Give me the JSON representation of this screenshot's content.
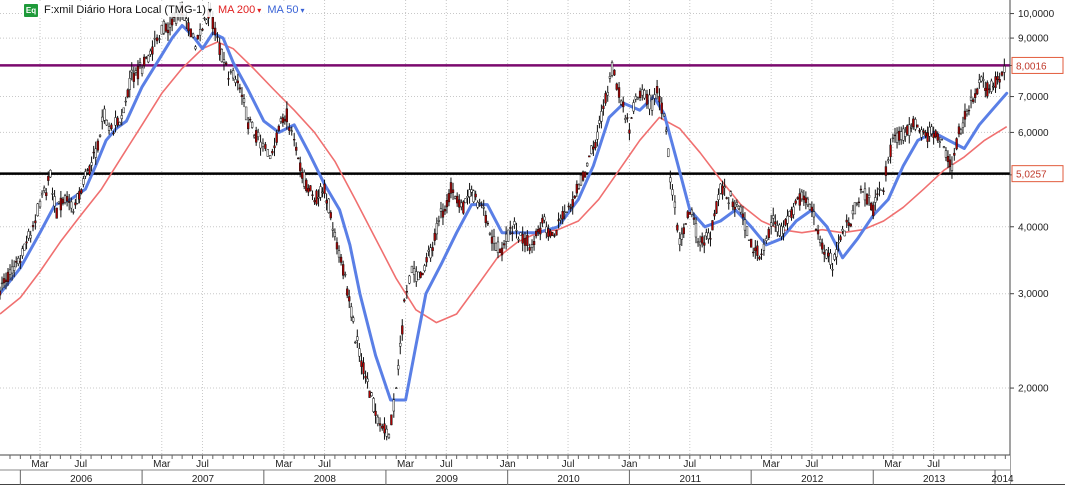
{
  "legend": {
    "badge": "Eq",
    "symbol": "F:xmil Diário Hora Local (TMG-1)",
    "ma200_label": "MA 200",
    "ma50_label": "MA 50",
    "caret": "▾"
  },
  "colors": {
    "price": "#111111",
    "price_down_body": "#b00000",
    "ma200": "#f07070",
    "ma50": "#5a7fe6",
    "upper_line": "#7b0a6e",
    "lower_line": "#000000",
    "upper_badge": "#e25b3c",
    "lower_badge": "#e25b3c",
    "grid": "#c8c8c8",
    "badge_eq": "#1f9a3a"
  },
  "chart_data": {
    "type": "line",
    "y_scale": "log",
    "ylim": [
      1.5,
      10.6
    ],
    "y_ticks": [
      "10,0000",
      "9,0000",
      "8,0000",
      "7,0000",
      "6,0000",
      "5,0000",
      "4,0000",
      "3,0000",
      "2,0000"
    ],
    "y_tick_values": [
      10,
      9,
      8,
      7,
      6,
      5,
      4,
      3,
      2
    ],
    "xlim": [
      "2005-11-01",
      "2014-02-15"
    ],
    "grid": true,
    "legend_position": "top-left",
    "month_ticks": [
      {
        "label": "Mar",
        "date": "2006-03-01"
      },
      {
        "label": "Jul",
        "date": "2006-07-01"
      },
      {
        "label": "Mar",
        "date": "2007-03-01"
      },
      {
        "label": "Jul",
        "date": "2007-07-01"
      },
      {
        "label": "Mar",
        "date": "2008-03-01"
      },
      {
        "label": "Jul",
        "date": "2008-07-01"
      },
      {
        "label": "Mar",
        "date": "2009-03-01"
      },
      {
        "label": "Jul",
        "date": "2009-07-01"
      },
      {
        "label": "Jan",
        "date": "2010-01-01"
      },
      {
        "label": "Jul",
        "date": "2010-07-01"
      },
      {
        "label": "Jan",
        "date": "2011-01-01"
      },
      {
        "label": "Jul",
        "date": "2011-07-01"
      },
      {
        "label": "Mar",
        "date": "2012-03-01"
      },
      {
        "label": "Jul",
        "date": "2012-07-01"
      },
      {
        "label": "Mar",
        "date": "2013-03-01"
      },
      {
        "label": "Jul",
        "date": "2013-07-01"
      }
    ],
    "year_ticks": [
      {
        "label": "2006",
        "start": "2006-01-01"
      },
      {
        "label": "2007",
        "start": "2007-01-01"
      },
      {
        "label": "2008",
        "start": "2008-01-01"
      },
      {
        "label": "2009",
        "start": "2009-01-01"
      },
      {
        "label": "2010",
        "start": "2010-01-01"
      },
      {
        "label": "2011",
        "start": "2011-01-01"
      },
      {
        "label": "2012",
        "start": "2012-01-01"
      },
      {
        "label": "2013",
        "start": "2013-01-01"
      },
      {
        "label": "2014",
        "start": "2014-01-01"
      }
    ],
    "horizontal_lines": [
      {
        "value": 8.0016,
        "label": "8,0016",
        "color_key": "upper_line"
      },
      {
        "value": 5.0257,
        "label": "5,0257",
        "color_key": "lower_line"
      }
    ],
    "series": [
      {
        "name": "F:xmil",
        "role": "price",
        "points": [
          [
            "2005-11-01",
            3.05
          ],
          [
            "2005-12-01",
            3.25
          ],
          [
            "2006-01-01",
            3.55
          ],
          [
            "2006-02-01",
            3.9
          ],
          [
            "2006-03-01",
            4.4
          ],
          [
            "2006-04-01",
            4.95
          ],
          [
            "2006-04-20",
            4.25
          ],
          [
            "2006-05-15",
            4.55
          ],
          [
            "2006-06-15",
            4.35
          ],
          [
            "2006-07-15",
            4.95
          ],
          [
            "2006-08-15",
            5.5
          ],
          [
            "2006-09-10",
            6.45
          ],
          [
            "2006-10-01",
            6.1
          ],
          [
            "2006-11-01",
            6.4
          ],
          [
            "2006-12-01",
            7.6
          ],
          [
            "2007-01-01",
            7.9
          ],
          [
            "2007-02-01",
            8.7
          ],
          [
            "2007-03-01",
            9.3
          ],
          [
            "2007-04-01",
            9.6
          ],
          [
            "2007-05-01",
            10.2
          ],
          [
            "2007-05-20",
            9.5
          ],
          [
            "2007-06-10",
            8.6
          ],
          [
            "2007-07-01",
            9.4
          ],
          [
            "2007-07-25",
            10.15
          ],
          [
            "2007-08-15",
            8.8
          ],
          [
            "2007-09-10",
            7.9
          ],
          [
            "2007-10-15",
            7.4
          ],
          [
            "2007-11-15",
            6.3
          ],
          [
            "2007-12-15",
            5.8
          ],
          [
            "2008-01-20",
            5.4
          ],
          [
            "2008-02-15",
            6.1
          ],
          [
            "2008-03-10",
            6.5
          ],
          [
            "2008-04-01",
            5.8
          ],
          [
            "2008-05-01",
            4.9
          ],
          [
            "2008-06-01",
            4.5
          ],
          [
            "2008-07-01",
            4.7
          ],
          [
            "2008-08-01",
            3.9
          ],
          [
            "2008-09-01",
            3.2
          ],
          [
            "2008-10-01",
            2.5
          ],
          [
            "2008-11-01",
            2.1
          ],
          [
            "2008-12-01",
            1.8
          ],
          [
            "2009-01-10",
            1.62
          ],
          [
            "2009-02-01",
            2.0
          ],
          [
            "2009-02-25",
            2.85
          ],
          [
            "2009-03-20",
            3.3
          ],
          [
            "2009-04-15",
            3.2
          ],
          [
            "2009-05-15",
            3.6
          ],
          [
            "2009-06-15",
            4.2
          ],
          [
            "2009-07-15",
            4.7
          ],
          [
            "2009-08-15",
            4.3
          ],
          [
            "2009-09-15",
            4.6
          ],
          [
            "2009-10-15",
            4.4
          ],
          [
            "2009-11-15",
            3.8
          ],
          [
            "2009-12-15",
            3.6
          ],
          [
            "2010-01-15",
            4.0
          ],
          [
            "2010-02-15",
            3.8
          ],
          [
            "2010-03-15",
            3.7
          ],
          [
            "2010-04-15",
            4.1
          ],
          [
            "2010-05-15",
            3.8
          ],
          [
            "2010-06-15",
            4.2
          ],
          [
            "2010-07-15",
            4.5
          ],
          [
            "2010-08-15",
            5.0
          ],
          [
            "2010-09-15",
            5.6
          ],
          [
            "2010-10-15",
            6.6
          ],
          [
            "2010-11-10",
            7.9
          ],
          [
            "2010-12-01",
            7.1
          ],
          [
            "2011-01-01",
            6.1
          ],
          [
            "2011-01-20",
            6.9
          ],
          [
            "2011-02-15",
            7.1
          ],
          [
            "2011-03-10",
            6.7
          ],
          [
            "2011-03-25",
            7.3
          ],
          [
            "2011-04-15",
            6.4
          ],
          [
            "2011-05-10",
            4.6
          ],
          [
            "2011-06-01",
            3.8
          ],
          [
            "2011-07-01",
            4.3
          ],
          [
            "2011-08-01",
            3.7
          ],
          [
            "2011-09-01",
            3.9
          ],
          [
            "2011-10-01",
            4.7
          ],
          [
            "2011-11-01",
            4.5
          ],
          [
            "2011-12-01",
            4.3
          ],
          [
            "2012-01-01",
            3.7
          ],
          [
            "2012-02-01",
            3.5
          ],
          [
            "2012-03-01",
            4.1
          ],
          [
            "2012-04-01",
            3.9
          ],
          [
            "2012-05-01",
            4.2
          ],
          [
            "2012-06-01",
            4.6
          ],
          [
            "2012-07-01",
            4.3
          ],
          [
            "2012-08-01",
            3.7
          ],
          [
            "2012-09-01",
            3.4
          ],
          [
            "2012-10-01",
            3.9
          ],
          [
            "2012-11-01",
            4.2
          ],
          [
            "2012-12-01",
            4.7
          ],
          [
            "2013-01-01",
            4.3
          ],
          [
            "2013-02-01",
            4.8
          ],
          [
            "2013-03-01",
            5.8
          ],
          [
            "2013-04-01",
            5.9
          ],
          [
            "2013-05-01",
            6.2
          ],
          [
            "2013-06-01",
            5.9
          ],
          [
            "2013-07-01",
            6.0
          ],
          [
            "2013-08-01",
            5.6
          ],
          [
            "2013-08-25",
            5.2
          ],
          [
            "2013-09-15",
            6.0
          ],
          [
            "2013-10-15",
            6.8
          ],
          [
            "2013-11-15",
            7.4
          ],
          [
            "2013-12-15",
            7.2
          ],
          [
            "2014-01-15",
            7.6
          ],
          [
            "2014-02-05",
            8.1
          ]
        ]
      },
      {
        "name": "MA 200",
        "role": "ma200",
        "points": [
          [
            "2005-11-01",
            2.75
          ],
          [
            "2006-01-01",
            2.95
          ],
          [
            "2006-03-01",
            3.3
          ],
          [
            "2006-05-01",
            3.75
          ],
          [
            "2006-07-01",
            4.2
          ],
          [
            "2006-09-01",
            4.7
          ],
          [
            "2006-11-01",
            5.4
          ],
          [
            "2007-01-01",
            6.2
          ],
          [
            "2007-03-01",
            7.1
          ],
          [
            "2007-05-01",
            7.9
          ],
          [
            "2007-07-01",
            8.6
          ],
          [
            "2007-08-15",
            8.85
          ],
          [
            "2007-10-01",
            8.6
          ],
          [
            "2007-12-01",
            7.9
          ],
          [
            "2008-02-01",
            7.2
          ],
          [
            "2008-04-01",
            6.6
          ],
          [
            "2008-06-01",
            6.0
          ],
          [
            "2008-08-01",
            5.3
          ],
          [
            "2008-10-01",
            4.5
          ],
          [
            "2008-12-01",
            3.8
          ],
          [
            "2009-02-01",
            3.2
          ],
          [
            "2009-04-01",
            2.8
          ],
          [
            "2009-06-01",
            2.65
          ],
          [
            "2009-08-01",
            2.75
          ],
          [
            "2009-10-01",
            3.1
          ],
          [
            "2009-12-01",
            3.5
          ],
          [
            "2010-02-01",
            3.75
          ],
          [
            "2010-04-01",
            3.9
          ],
          [
            "2010-06-01",
            3.95
          ],
          [
            "2010-08-01",
            4.1
          ],
          [
            "2010-10-01",
            4.5
          ],
          [
            "2010-12-01",
            5.1
          ],
          [
            "2011-02-01",
            5.8
          ],
          [
            "2011-04-01",
            6.4
          ],
          [
            "2011-06-01",
            6.1
          ],
          [
            "2011-08-01",
            5.5
          ],
          [
            "2011-10-01",
            4.9
          ],
          [
            "2011-12-01",
            4.4
          ],
          [
            "2012-02-01",
            4.1
          ],
          [
            "2012-04-01",
            3.95
          ],
          [
            "2012-06-01",
            3.9
          ],
          [
            "2012-08-01",
            3.95
          ],
          [
            "2012-10-01",
            3.9
          ],
          [
            "2012-12-01",
            3.95
          ],
          [
            "2013-02-01",
            4.1
          ],
          [
            "2013-04-01",
            4.35
          ],
          [
            "2013-06-01",
            4.7
          ],
          [
            "2013-08-01",
            5.1
          ],
          [
            "2013-10-01",
            5.4
          ],
          [
            "2013-12-01",
            5.8
          ],
          [
            "2014-02-05",
            6.15
          ]
        ]
      },
      {
        "name": "MA 50",
        "role": "ma50",
        "points": [
          [
            "2005-11-01",
            3.0
          ],
          [
            "2006-01-01",
            3.35
          ],
          [
            "2006-03-01",
            3.9
          ],
          [
            "2006-04-15",
            4.4
          ],
          [
            "2006-06-01",
            4.5
          ],
          [
            "2006-07-15",
            4.7
          ],
          [
            "2006-08-15",
            5.2
          ],
          [
            "2006-09-15",
            5.8
          ],
          [
            "2006-10-15",
            6.1
          ],
          [
            "2006-11-15",
            6.3
          ],
          [
            "2007-01-01",
            7.3
          ],
          [
            "2007-02-15",
            8.1
          ],
          [
            "2007-04-01",
            9.0
          ],
          [
            "2007-05-01",
            9.5
          ],
          [
            "2007-06-01",
            9.1
          ],
          [
            "2007-07-01",
            8.6
          ],
          [
            "2007-08-01",
            9.2
          ],
          [
            "2007-09-01",
            9.0
          ],
          [
            "2007-10-01",
            8.1
          ],
          [
            "2007-11-15",
            7.2
          ],
          [
            "2008-01-01",
            6.3
          ],
          [
            "2008-02-15",
            6.0
          ],
          [
            "2008-04-01",
            6.2
          ],
          [
            "2008-05-15",
            5.5
          ],
          [
            "2008-07-01",
            4.8
          ],
          [
            "2008-08-15",
            4.3
          ],
          [
            "2008-09-15",
            3.7
          ],
          [
            "2008-10-15",
            3.0
          ],
          [
            "2008-12-01",
            2.3
          ],
          [
            "2009-01-15",
            1.9
          ],
          [
            "2009-03-01",
            1.9
          ],
          [
            "2009-04-01",
            2.4
          ],
          [
            "2009-05-01",
            3.0
          ],
          [
            "2009-06-15",
            3.4
          ],
          [
            "2009-08-01",
            3.9
          ],
          [
            "2009-09-15",
            4.4
          ],
          [
            "2009-11-01",
            4.4
          ],
          [
            "2009-12-15",
            3.9
          ],
          [
            "2010-02-01",
            3.9
          ],
          [
            "2010-04-01",
            3.9
          ],
          [
            "2010-06-01",
            4.0
          ],
          [
            "2010-08-01",
            4.5
          ],
          [
            "2010-09-15",
            5.2
          ],
          [
            "2010-11-01",
            6.4
          ],
          [
            "2010-12-15",
            6.8
          ],
          [
            "2011-02-01",
            6.6
          ],
          [
            "2011-03-15",
            7.0
          ],
          [
            "2011-04-15",
            6.5
          ],
          [
            "2011-05-20",
            5.4
          ],
          [
            "2011-07-01",
            4.3
          ],
          [
            "2011-08-15",
            4.0
          ],
          [
            "2011-10-01",
            4.1
          ],
          [
            "2011-11-15",
            4.3
          ],
          [
            "2012-01-01",
            4.0
          ],
          [
            "2012-02-15",
            3.7
          ],
          [
            "2012-04-01",
            3.8
          ],
          [
            "2012-05-15",
            4.1
          ],
          [
            "2012-07-01",
            4.3
          ],
          [
            "2012-08-15",
            4.0
          ],
          [
            "2012-10-01",
            3.5
          ],
          [
            "2012-11-15",
            3.8
          ],
          [
            "2013-01-01",
            4.2
          ],
          [
            "2013-02-15",
            4.5
          ],
          [
            "2013-04-01",
            5.2
          ],
          [
            "2013-05-15",
            5.8
          ],
          [
            "2013-07-01",
            6.0
          ],
          [
            "2013-08-15",
            5.8
          ],
          [
            "2013-10-01",
            5.6
          ],
          [
            "2013-11-15",
            6.2
          ],
          [
            "2014-01-01",
            6.7
          ],
          [
            "2014-02-05",
            7.1
          ]
        ]
      }
    ]
  }
}
